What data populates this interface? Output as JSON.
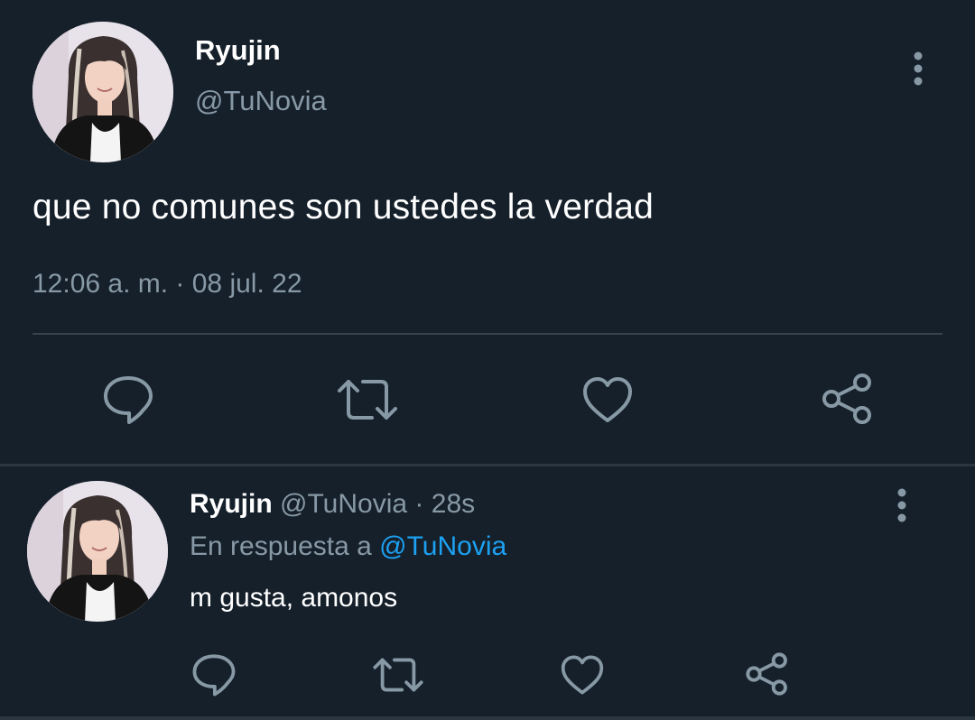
{
  "main_tweet": {
    "display_name": "Ryujin",
    "handle": "@TuNovia",
    "text": "que no comunes son ustedes la verdad",
    "timestamp": "12:06 a. m. · 08 jul. 22",
    "avatar": "profile-photo",
    "more_icon": "more-vertical-icon",
    "actions": {
      "reply_icon": "reply-icon",
      "retweet_icon": "retweet-icon",
      "like_icon": "heart-icon",
      "share_icon": "share-icon"
    }
  },
  "reply_tweet": {
    "display_name": "Ryujin",
    "handle": "@TuNovia",
    "separator": "·",
    "time": "28s",
    "reply_to_label": "En respuesta a",
    "reply_to_handle": "@TuNovia",
    "text": "m gusta, amonos",
    "avatar": "profile-photo",
    "more_icon": "more-vertical-icon",
    "actions": {
      "reply_icon": "reply-icon",
      "retweet_icon": "retweet-icon",
      "like_icon": "heart-icon",
      "share_icon": "share-icon"
    }
  },
  "colors": {
    "background": "#15202b",
    "primary_text": "#ffffff",
    "secondary_text": "#8899a6",
    "link": "#1da1f2",
    "divider": "#38444d",
    "icon": "#8899a6"
  }
}
